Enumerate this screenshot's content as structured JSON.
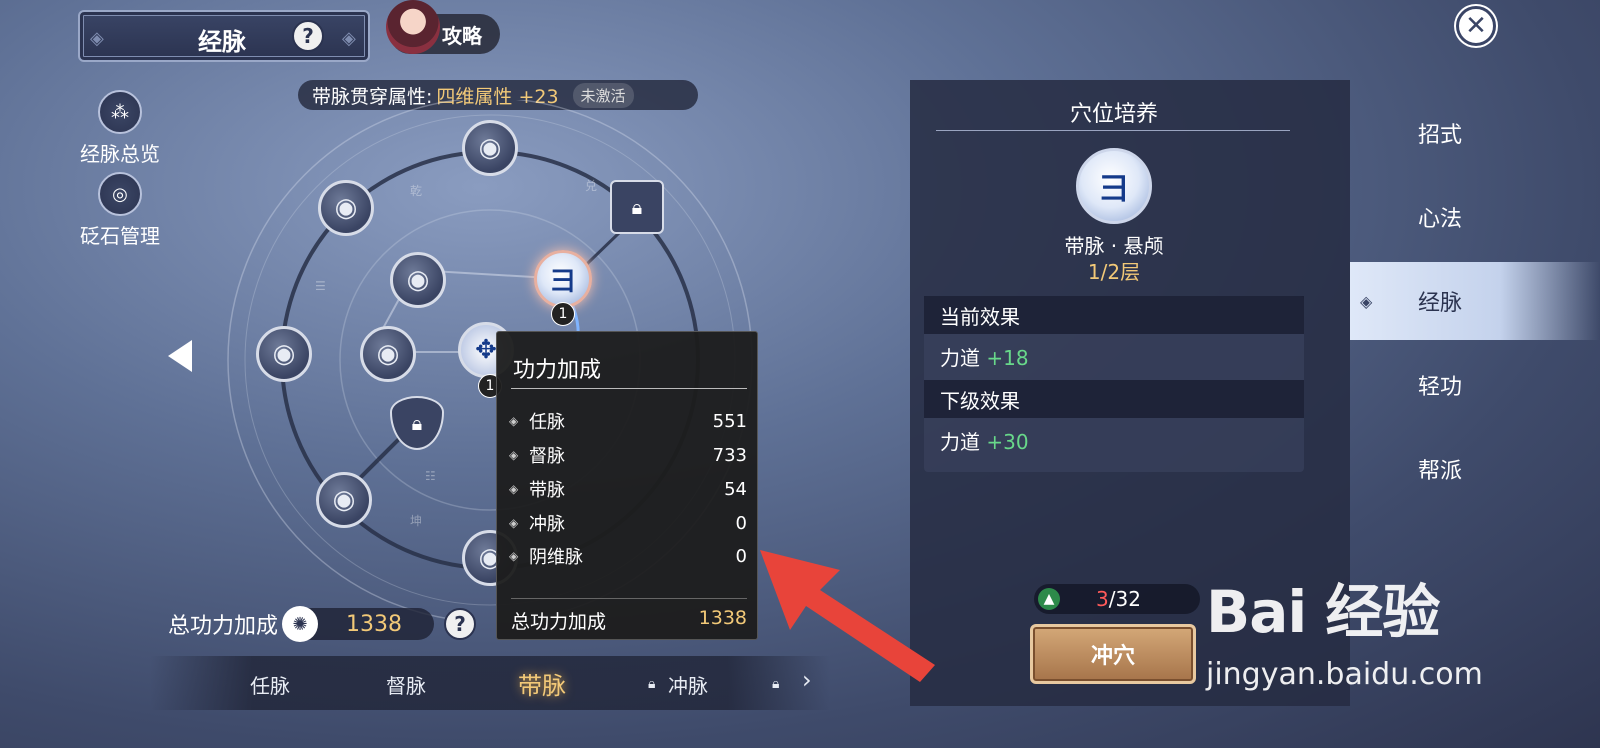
{
  "header": {
    "title": "经脉",
    "help": "?",
    "guide_label": "攻略",
    "close": "✕"
  },
  "attr_bar": {
    "label": "带脉贯穿属性:",
    "value": "四维属性 +23",
    "status": "未激活"
  },
  "side_tools": [
    {
      "label": "经脉总览",
      "icon": "network-icon"
    },
    {
      "label": "砭石管理",
      "icon": "stone-ring-icon"
    }
  ],
  "wheel": {
    "active_node_glyph": "彐",
    "badge_values": [
      "1",
      "1"
    ]
  },
  "tooltip": {
    "title": "功力加成",
    "rows": [
      {
        "name": "任脉",
        "value": "551"
      },
      {
        "name": "督脉",
        "value": "733"
      },
      {
        "name": "带脉",
        "value": "54"
      },
      {
        "name": "冲脉",
        "value": "0"
      },
      {
        "name": "阴维脉",
        "value": "0"
      }
    ],
    "total_label": "总功力加成",
    "total_value": "1338"
  },
  "total_power": {
    "label": "总功力加成",
    "value": "1338",
    "help": "?"
  },
  "meridian_tabs": [
    {
      "label": "任脉",
      "locked": false,
      "selected": false
    },
    {
      "label": "督脉",
      "locked": false,
      "selected": false
    },
    {
      "label": "带脉",
      "locked": false,
      "selected": true
    },
    {
      "label": "冲脉",
      "locked": true,
      "selected": false
    }
  ],
  "panel": {
    "title": "穴位培养",
    "acupoint_name": "带脉 · 悬颅",
    "acupoint_level": "1/2层",
    "current_effect_label": "当前效果",
    "current_stat": "力道",
    "current_value": "+18",
    "next_effect_label": "下级效果",
    "next_stat": "力道",
    "next_value": "+30",
    "count_current": "3",
    "count_total": "/32",
    "action_button": "冲穴"
  },
  "right_nav": [
    {
      "label": "招式",
      "selected": false
    },
    {
      "label": "心法",
      "selected": false
    },
    {
      "label": "经脉",
      "selected": true
    },
    {
      "label": "轻功",
      "selected": false
    },
    {
      "label": "帮派",
      "selected": false
    }
  ],
  "watermark": {
    "brand": "Bai  经验",
    "url": "jingyan.baidu.com"
  },
  "colors": {
    "gold": "#f2c978",
    "green": "#68d88a",
    "red_count": "#ff5a5a",
    "arrow": "#e8443a"
  }
}
